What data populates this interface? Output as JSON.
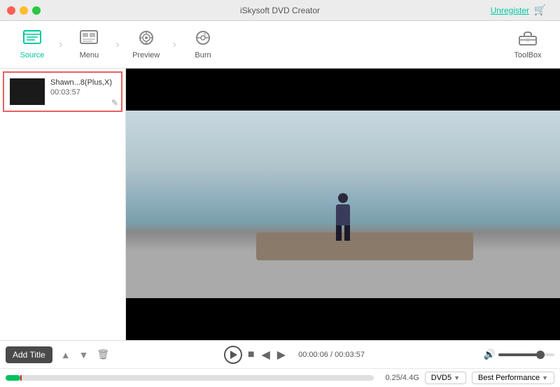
{
  "titlebar": {
    "title": "iSkysoft DVD Creator",
    "unregister_label": "Unregister"
  },
  "toolbar": {
    "items": [
      {
        "id": "source",
        "label": "Source",
        "icon": "📋",
        "active": true
      },
      {
        "id": "menu",
        "label": "Menu",
        "icon": "🖼",
        "active": false
      },
      {
        "id": "preview",
        "label": "Preview",
        "icon": "⊙",
        "active": false
      },
      {
        "id": "burn",
        "label": "Burn",
        "icon": "◎",
        "active": false
      }
    ],
    "toolbox_label": "ToolBox"
  },
  "sidebar": {
    "items": [
      {
        "name": "Shawn...8(Plus,X)",
        "duration": "00:03:57"
      }
    ]
  },
  "controls": {
    "add_title_label": "Add Title",
    "time_current": "00:00:06",
    "time_total": "00:03:57",
    "file_size": "0.25/4.4G",
    "dvd_format": "DVD5",
    "quality": "Best Performance"
  }
}
